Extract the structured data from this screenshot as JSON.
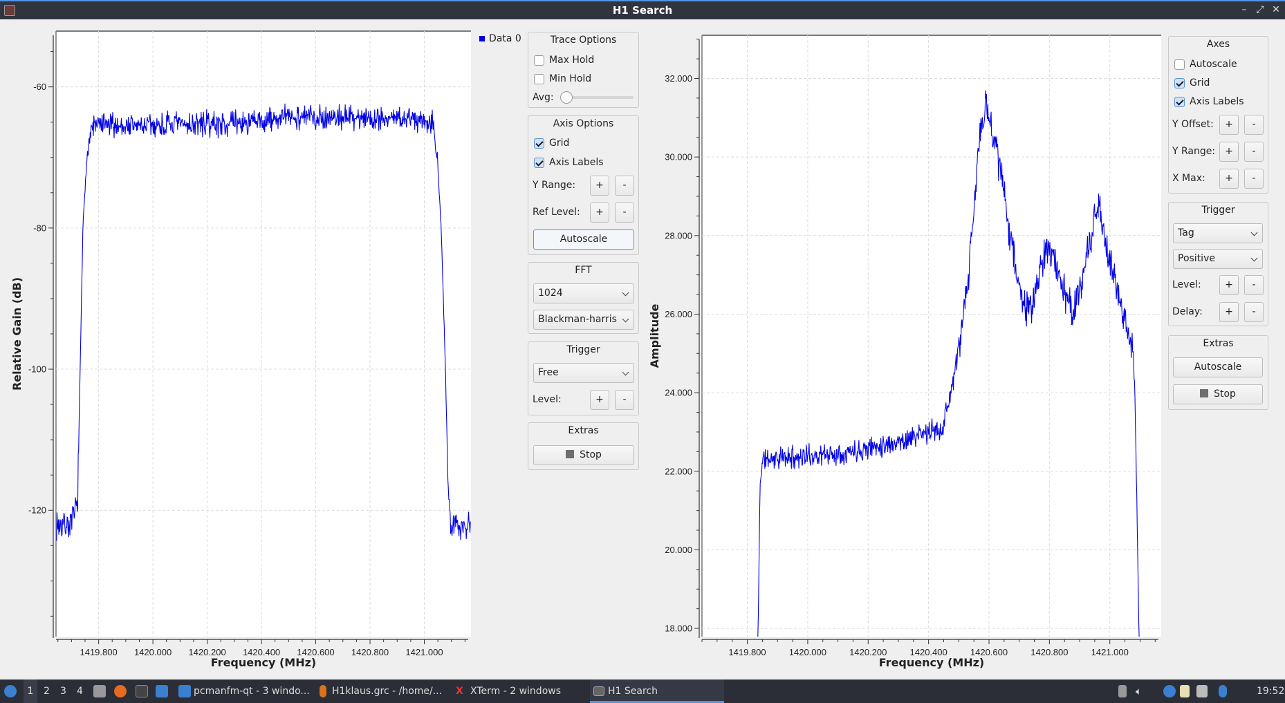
{
  "window": {
    "title": "H1 Search",
    "controls": [
      "minimize-icon",
      "maximize-icon",
      "close-icon"
    ]
  },
  "left_panel": {
    "legend": "Data 0",
    "trace_options": {
      "title": "Trace Options",
      "max_hold": {
        "label": "Max Hold",
        "checked": false
      },
      "min_hold": {
        "label": "Min Hold",
        "checked": false
      },
      "avg_label": "Avg:",
      "avg_value": 0
    },
    "axis_options": {
      "title": "Axis Options",
      "grid": {
        "label": "Grid",
        "checked": true
      },
      "axis_labels": {
        "label": "Axis Labels",
        "checked": true
      },
      "y_range": "Y Range:",
      "ref_level": "Ref Level:",
      "plus": "+",
      "minus": "-",
      "autoscale": "Autoscale"
    },
    "fft": {
      "title": "FFT",
      "size": "1024",
      "window": "Blackman-harris"
    },
    "trigger": {
      "title": "Trigger",
      "mode": "Free",
      "level": "Level:",
      "plus": "+",
      "minus": "-"
    },
    "extras": {
      "title": "Extras",
      "stop": "Stop"
    }
  },
  "right_panel": {
    "axes": {
      "title": "Axes",
      "autoscale": {
        "label": "Autoscale",
        "checked": false
      },
      "grid": {
        "label": "Grid",
        "checked": true
      },
      "axis_labels": {
        "label": "Axis Labels",
        "checked": true
      },
      "y_offset": "Y Offset:",
      "y_range": "Y Range:",
      "x_max": "X Max:",
      "plus": "+",
      "minus": "-"
    },
    "trigger": {
      "title": "Trigger",
      "mode": "Tag",
      "slope": "Positive",
      "level": "Level:",
      "delay": "Delay:",
      "plus": "+",
      "minus": "-"
    },
    "extras": {
      "title": "Extras",
      "autoscale": "Autoscale",
      "stop": "Stop"
    }
  },
  "taskbar": {
    "desktops": [
      "1",
      "2",
      "3",
      "4"
    ],
    "active_desktop": "1",
    "tasks": [
      {
        "label": "pcmanfm-qt - 3 windo...",
        "icon": "folder-icon"
      },
      {
        "label": "H1klaus.grc - /home/...",
        "icon": "gnuradio-icon"
      },
      {
        "label": "XTerm - 2 windows",
        "icon": "xterm-icon"
      },
      {
        "label": "H1 Search",
        "icon": "window-icon",
        "active": true
      }
    ],
    "clock": "19:52"
  },
  "chart_data": [
    {
      "type": "line",
      "xlabel": "Frequency (MHz)",
      "ylabel": "Relative Gain (dB)",
      "xlim": [
        1419.643,
        1421.172
      ],
      "ylim": [
        -137.9,
        -52.1
      ],
      "x_ticks": [
        1419.8,
        1420.0,
        1420.2,
        1420.4,
        1420.6,
        1420.8,
        1421.0
      ],
      "x_tick_labels": [
        "1419.800",
        "1420.000",
        "1420.200",
        "1420.400",
        "1420.600",
        "1420.800",
        "1421.000"
      ],
      "y_ticks": [
        -60,
        -80,
        -100,
        -120
      ],
      "y_tick_labels": [
        "-60",
        "-80",
        "-100",
        "-120"
      ],
      "grid": true,
      "legend": "top-right (outside)",
      "color": "#0000e6",
      "series": [
        {
          "name": "Data 0",
          "envelope": [
            [
              1419.645,
              -122
            ],
            [
              1419.7,
              -122
            ],
            [
              1419.722,
              -119
            ],
            [
              1419.73,
              -104
            ],
            [
              1419.742,
              -80
            ],
            [
              1419.76,
              -68
            ],
            [
              1419.78,
              -65.5
            ],
            [
              1420.0,
              -65.5
            ],
            [
              1420.4,
              -65
            ],
            [
              1420.5,
              -64.2
            ],
            [
              1420.75,
              -64.3
            ],
            [
              1421.0,
              -64.6
            ],
            [
              1421.035,
              -65
            ],
            [
              1421.048,
              -70
            ],
            [
              1421.062,
              -80
            ],
            [
              1421.078,
              -100
            ],
            [
              1421.088,
              -118
            ],
            [
              1421.1,
              -122
            ],
            [
              1421.17,
              -122
            ]
          ]
        }
      ]
    },
    {
      "type": "line",
      "xlabel": "Frequency (MHz)",
      "ylabel": "Amplitude",
      "xlim": [
        1419.65,
        1421.17
      ],
      "ylim": [
        17.79,
        33.1
      ],
      "x_ticks": [
        1419.8,
        1420.0,
        1420.2,
        1420.4,
        1420.6,
        1420.8,
        1421.0
      ],
      "x_tick_labels": [
        "1419.800",
        "1420.000",
        "1420.200",
        "1420.400",
        "1420.600",
        "1420.800",
        "1421.000"
      ],
      "y_ticks": [
        32,
        30,
        28,
        26,
        24,
        22,
        20,
        18
      ],
      "y_tick_labels": [
        "32.000",
        "30.000",
        "28.000",
        "26.000",
        "24.000",
        "22.000",
        "20.000",
        "18.000"
      ],
      "grid": true,
      "color": "#0000e6",
      "series": [
        {
          "envelope": [
            [
              1419.835,
              17.5
            ],
            [
              1419.842,
              21.5
            ],
            [
              1419.849,
              22.3
            ],
            [
              1420.1,
              22.45
            ],
            [
              1420.3,
              22.75
            ],
            [
              1420.446,
              23.1
            ],
            [
              1420.487,
              24.5
            ],
            [
              1420.527,
              26.5
            ],
            [
              1420.549,
              28.5
            ],
            [
              1420.568,
              30.5
            ],
            [
              1420.59,
              31.3
            ],
            [
              1420.622,
              30.4
            ],
            [
              1420.663,
              28.4
            ],
            [
              1420.704,
              26.5
            ],
            [
              1420.736,
              26.0
            ],
            [
              1420.766,
              27.0
            ],
            [
              1420.799,
              27.8
            ],
            [
              1420.84,
              26.8
            ],
            [
              1420.88,
              26.0
            ],
            [
              1420.921,
              27.3
            ],
            [
              1420.961,
              28.8
            ],
            [
              1420.994,
              27.5
            ],
            [
              1421.029,
              26.5
            ],
            [
              1421.07,
              25.3
            ],
            [
              1421.081,
              24.6
            ],
            [
              1421.092,
              20.0
            ],
            [
              1421.097,
              17.5
            ]
          ]
        }
      ]
    }
  ]
}
